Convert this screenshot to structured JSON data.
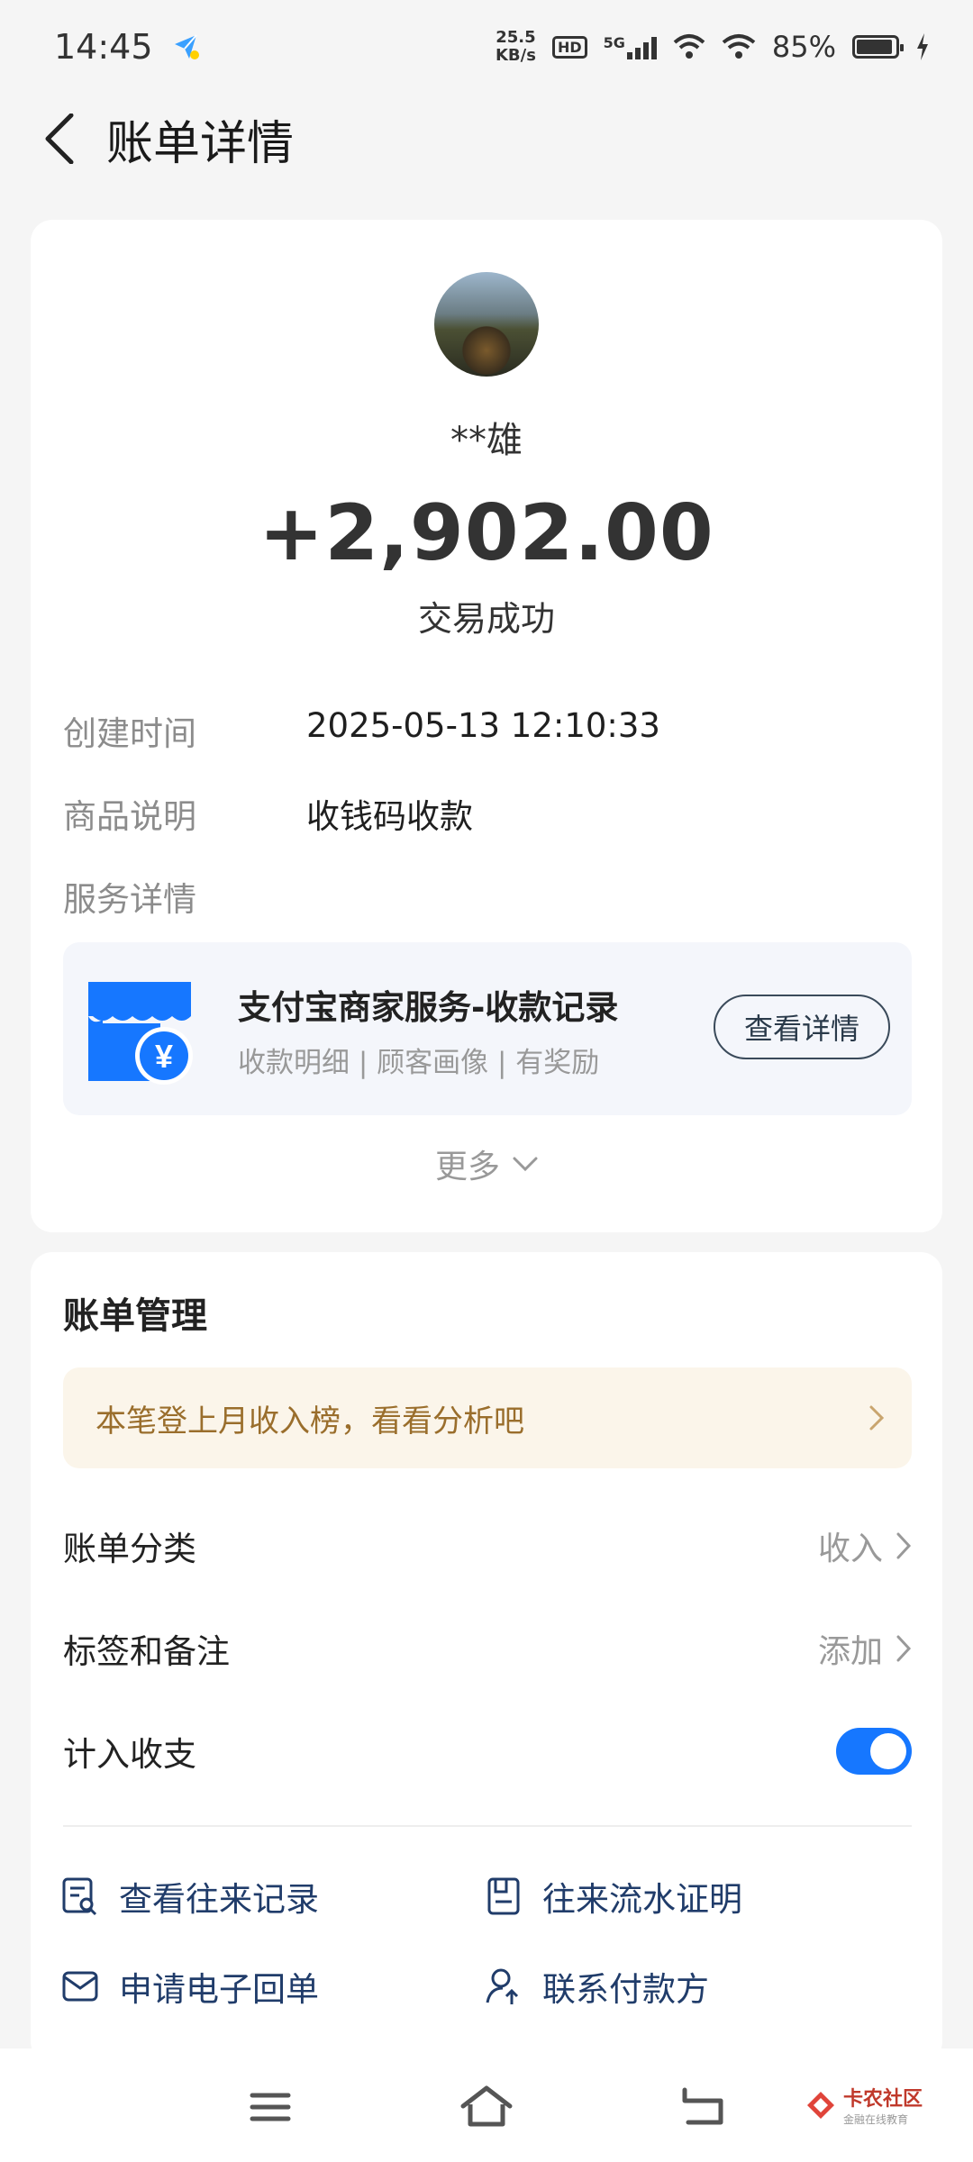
{
  "status_bar": {
    "time": "14:45",
    "net_speed_value": "25.5",
    "net_speed_unit": "KB/s",
    "hd": "HD",
    "net_type": "5G",
    "battery": "85%"
  },
  "header": {
    "title": "账单详情"
  },
  "transaction": {
    "payer": "**雄",
    "amount": "+2,902.00",
    "status": "交易成功",
    "created_label": "创建时间",
    "created_value": "2025-05-13 12:10:33",
    "desc_label": "商品说明",
    "desc_value": "收钱码收款",
    "service_label": "服务详情"
  },
  "service": {
    "title": "支付宝商家服务-收款记录",
    "subtitle": "收款明细 | 顾客画像 | 有奖励",
    "button": "查看详情",
    "currency_symbol": "¥"
  },
  "more_label": "更多",
  "manage": {
    "title": "账单管理",
    "promo": "本笔登上月收入榜，看看分析吧",
    "category_label": "账单分类",
    "category_value": "收入",
    "tag_label": "标签和备注",
    "tag_value": "添加",
    "include_label": "计入收支",
    "include_on": true,
    "actions": [
      {
        "label": "查看往来记录",
        "icon": "record-search-icon"
      },
      {
        "label": "往来流水证明",
        "icon": "statement-icon"
      },
      {
        "label": "申请电子回单",
        "icon": "mail-icon"
      },
      {
        "label": "联系付款方",
        "icon": "contact-user-icon"
      }
    ]
  },
  "watermark": {
    "name": "卡农社区",
    "tagline": "金融在线教育"
  },
  "colors": {
    "accent": "#1677ff",
    "promo_text": "#9a6e2c",
    "action_text": "#203c6a"
  }
}
